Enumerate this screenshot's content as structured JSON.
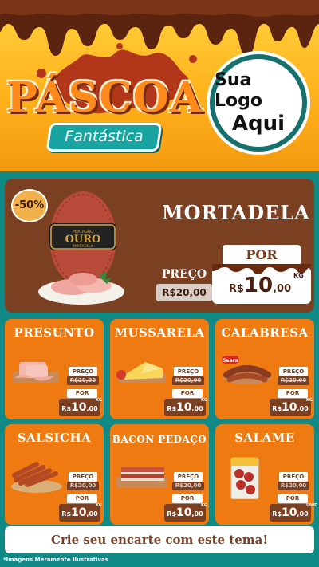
{
  "header": {
    "title": "PÁSCOA",
    "subtitle": "Fantástica",
    "logo_line1": "Sua Logo",
    "logo_line2": "Aqui"
  },
  "featured": {
    "discount": "-50%",
    "name": "MORTADELA",
    "preco_label": "PREÇO",
    "old_price": "R$20,00",
    "por_label": "POR",
    "currency": "R$",
    "price_main": "10",
    "price_cents": ",00",
    "unit": "KG",
    "brand_top": "PERDIGÃO",
    "brand_name": "OURO",
    "brand_sub": "MORTADELA"
  },
  "products": [
    {
      "name": "PRESUNTO",
      "preco_label": "PREÇO",
      "old_price": "R$20,00",
      "por_label": "POR",
      "currency": "R$",
      "price_main": "10",
      "price_cents": ",00",
      "unit": "KG"
    },
    {
      "name": "MUSSARELA",
      "preco_label": "PREÇO",
      "old_price": "R$20,00",
      "por_label": "POR",
      "currency": "R$",
      "price_main": "10",
      "price_cents": ",00",
      "unit": "KG"
    },
    {
      "name": "CALABRESA",
      "brand": "Seara",
      "preco_label": "PREÇO",
      "old_price": "R$20,00",
      "por_label": "POR",
      "currency": "R$",
      "price_main": "10",
      "price_cents": ",00",
      "unit": "KG"
    },
    {
      "name": "SALSICHA",
      "preco_label": "PREÇO",
      "old_price": "R$20,00",
      "por_label": "POR",
      "currency": "R$",
      "price_main": "10",
      "price_cents": ",00",
      "unit": "KG"
    },
    {
      "name": "BACON PEDAÇO",
      "preco_label": "PREÇO",
      "old_price": "R$20,00",
      "por_label": "POR",
      "currency": "R$",
      "price_main": "10",
      "price_cents": ",00",
      "unit": "KG"
    },
    {
      "name": "SALAME",
      "preco_label": "PREÇO",
      "old_price": "R$20,00",
      "por_label": "POR",
      "currency": "R$",
      "price_main": "10",
      "price_cents": ",00",
      "unit": "UNID"
    }
  ],
  "footer": {
    "cta": "Crie seu encarte com este tema!",
    "disclaimer": "*Imagens Meramente Ilustrativas"
  },
  "colors": {
    "background_teal": "#0f8a86",
    "chocolate": "#7b3f22",
    "card_orange": "#f07a12",
    "header_yellow": "#ffd23f"
  }
}
